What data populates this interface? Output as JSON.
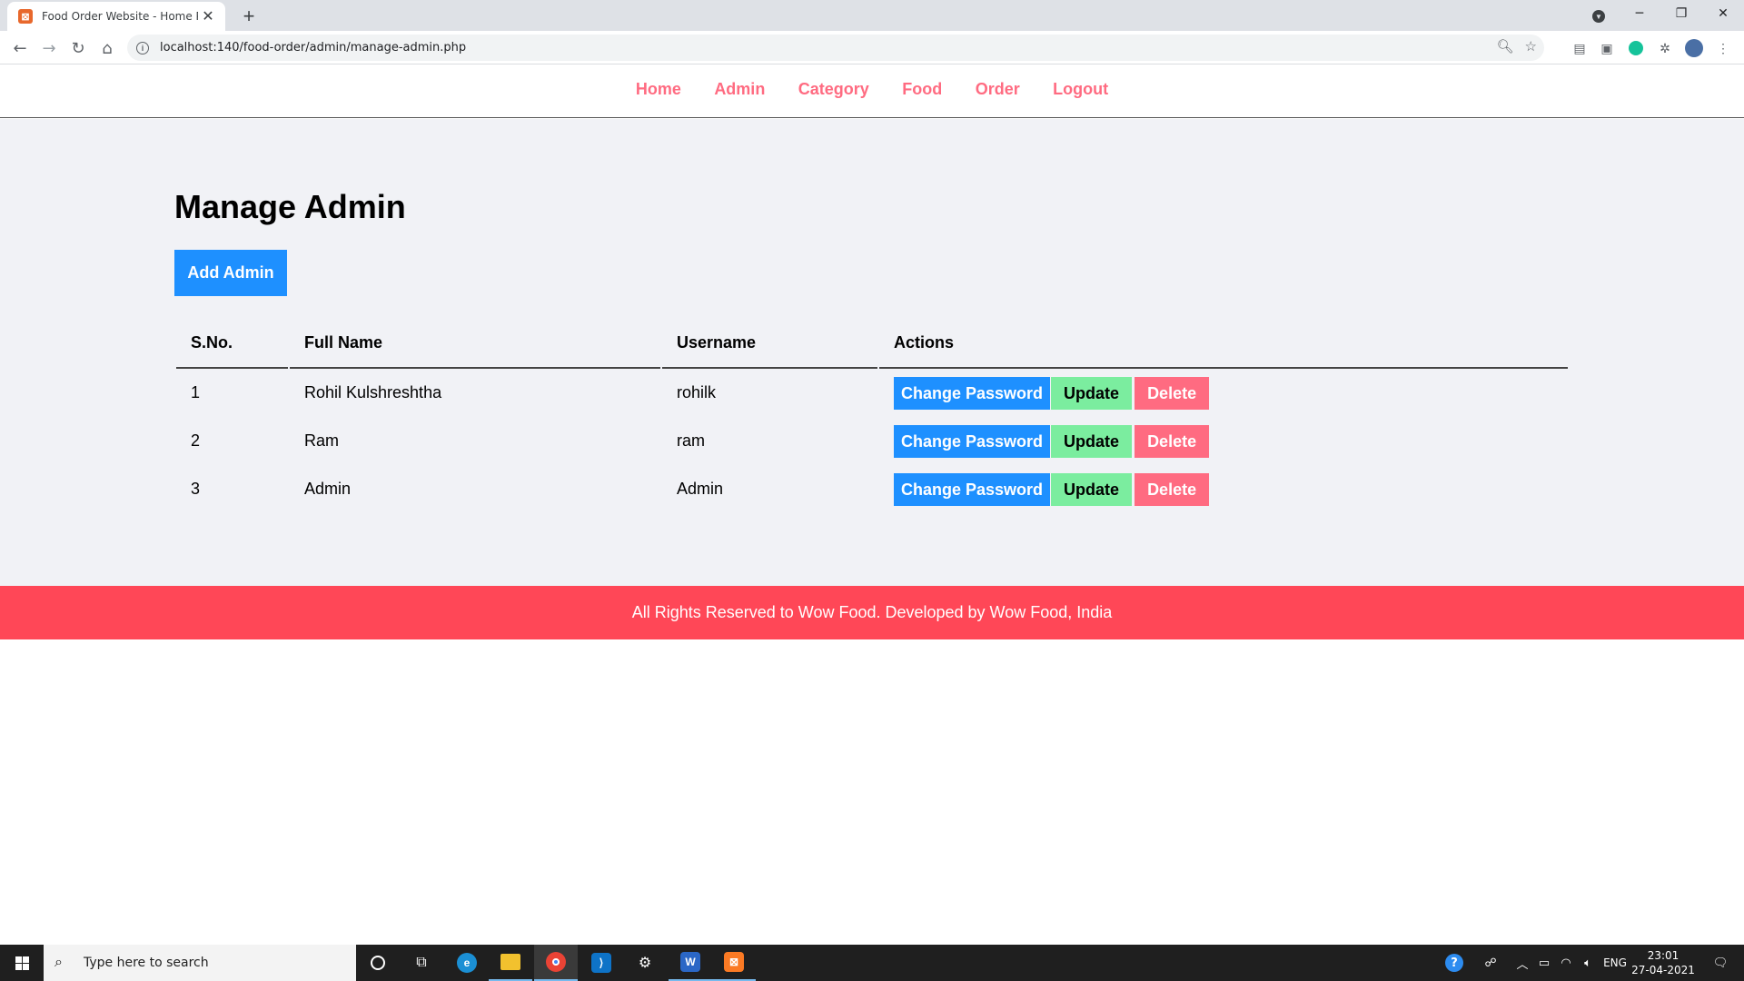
{
  "browser": {
    "tab_title": "Food Order Website - Home Page",
    "url": "localhost:140/food-order/admin/manage-admin.php"
  },
  "menu": [
    {
      "label": "Home"
    },
    {
      "label": "Admin"
    },
    {
      "label": "Category"
    },
    {
      "label": "Food"
    },
    {
      "label": "Order"
    },
    {
      "label": "Logout"
    }
  ],
  "main": {
    "title": "Manage Admin",
    "add_button": "Add Admin",
    "table": {
      "headers": [
        "S.No.",
        "Full Name",
        "Username",
        "Actions"
      ],
      "rows": [
        {
          "sn": "1",
          "full_name": "Rohil Kulshreshtha",
          "username": "rohilk"
        },
        {
          "sn": "2",
          "full_name": "Ram",
          "username": "ram"
        },
        {
          "sn": "3",
          "full_name": "Admin",
          "username": "Admin"
        }
      ],
      "actions": {
        "change_password": "Change Password",
        "update": "Update",
        "delete": "Delete"
      }
    }
  },
  "footer": {
    "text": "All Rights Reserved to Wow Food. Developed by Wow Food, India"
  },
  "taskbar": {
    "search_placeholder": "Type here to search",
    "language": "ENG",
    "time": "23:01",
    "date": "27-04-2021"
  },
  "colors": {
    "menu_link": "#ff6b81",
    "primary": "#1e90ff",
    "success": "#7bed9f",
    "danger": "#ff6b81",
    "footer": "#ff4757",
    "page_bg": "#f1f2f6"
  }
}
